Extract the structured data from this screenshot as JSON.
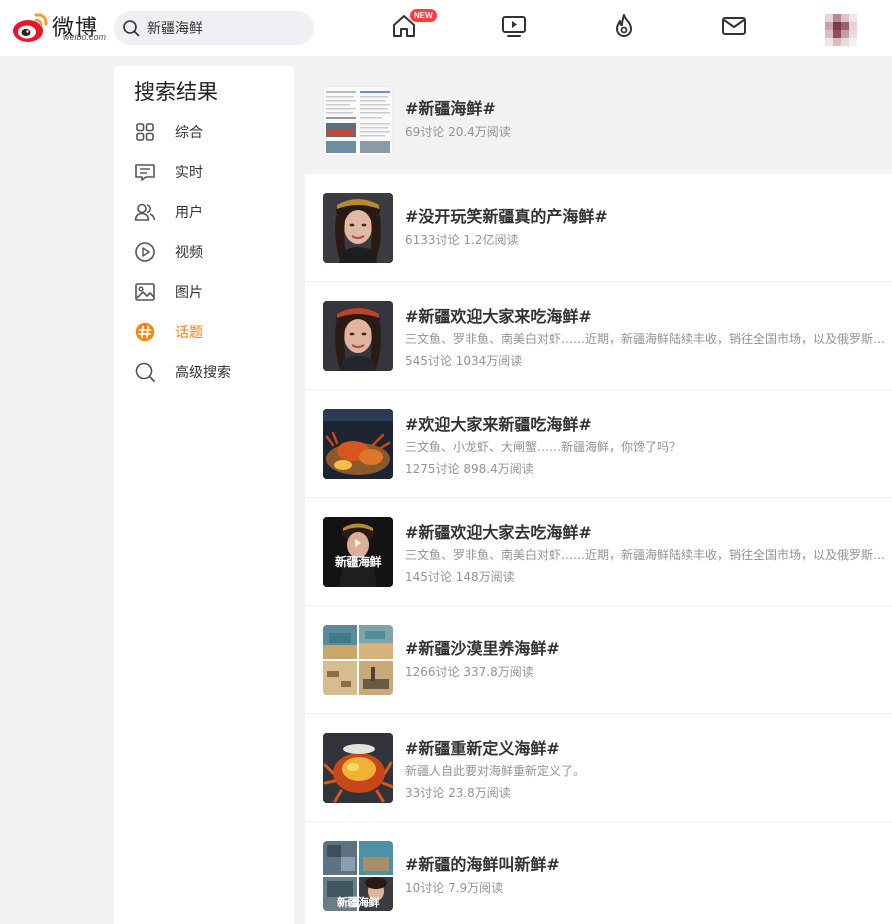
{
  "header": {
    "logo_text": "微博",
    "logo_sub": "weibo.com",
    "search_value": "新疆海鲜",
    "new_badge": "NEW",
    "accent_color": "#ff8200"
  },
  "sidebar": {
    "title": "搜索结果",
    "items": [
      {
        "label": "综合",
        "icon": "grid-icon"
      },
      {
        "label": "实时",
        "icon": "message-icon"
      },
      {
        "label": "用户",
        "icon": "users-icon"
      },
      {
        "label": "视频",
        "icon": "play-icon"
      },
      {
        "label": "图片",
        "icon": "image-icon"
      },
      {
        "label": "话题",
        "icon": "topic-icon",
        "active": true
      },
      {
        "label": "高级搜索",
        "icon": "search-icon"
      }
    ]
  },
  "results": [
    {
      "title": "#新疆海鲜#",
      "desc": "",
      "stats": "69讨论 20.4万阅读"
    },
    {
      "title": "#没开玩笑新疆真的产海鲜#",
      "desc": "",
      "stats": "6133讨论 1.2亿阅读"
    },
    {
      "title": "#新疆欢迎大家来吃海鲜#",
      "desc": "三文鱼、罗非鱼、南美白对虾……近期，新疆海鲜陆续丰收，销往全国市场，以及俄罗斯、哈萨克斯坦等国家",
      "stats": "545讨论 1034万阅读"
    },
    {
      "title": "#欢迎大家来新疆吃海鲜#",
      "desc": "三文鱼、小龙虾、大闸蟹……新疆海鲜，你馋了吗？",
      "stats": "1275讨论 898.4万阅读"
    },
    {
      "title": "#新疆欢迎大家去吃海鲜#",
      "desc": "三文鱼、罗非鱼、南美白对虾……近期，新疆海鲜陆续丰收，销往全国市场，以及俄罗斯、哈萨克斯坦等国家",
      "stats": "145讨论 148万阅读",
      "thumb_text": "新疆海鲜"
    },
    {
      "title": "#新疆沙漠里养海鲜#",
      "desc": "",
      "stats": "1266讨论 337.8万阅读"
    },
    {
      "title": "#新疆重新定义海鲜#",
      "desc": "新疆人自此要对海鲜重新定义了。",
      "stats": "33讨论 23.8万阅读"
    },
    {
      "title": "#新疆的海鲜叫新鲜#",
      "desc": "",
      "stats": "10讨论 7.9万阅读",
      "thumb_text": "新疆海鲜"
    }
  ]
}
